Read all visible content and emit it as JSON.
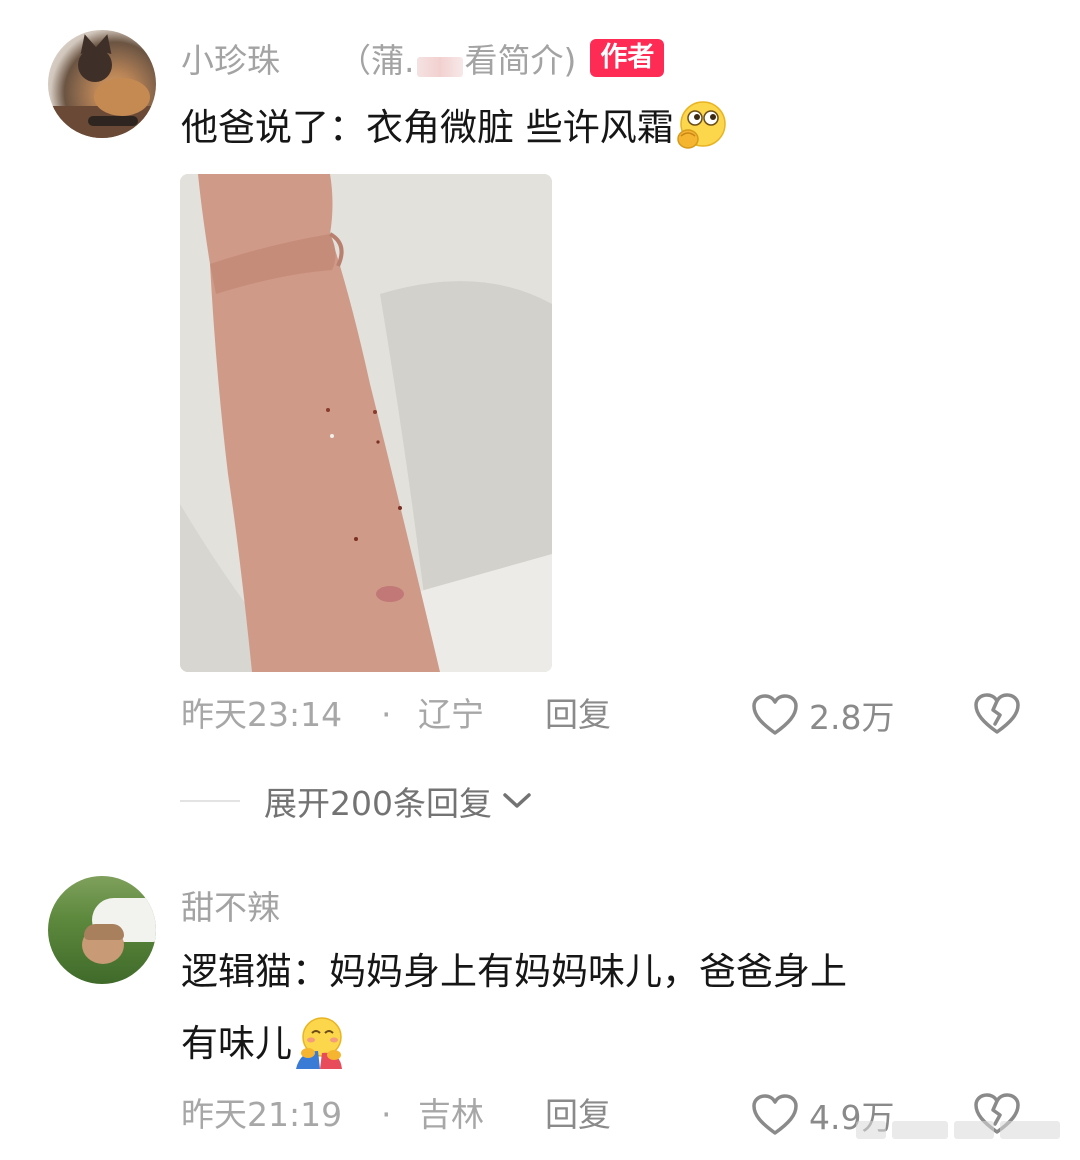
{
  "comments": [
    {
      "username": "小珍珠",
      "name_suffix_open": "（蒲.",
      "name_suffix_close": "看简介)",
      "author_badge": "作者",
      "text": "他爸说了：衣角微脏 些许风霜",
      "emoji": "hand-over-mouth-emoji",
      "has_photo": true,
      "time": "昨天23:14",
      "separator": "·",
      "region": "辽宁",
      "reply_label": "回复",
      "like_count": "2.8万"
    },
    {
      "username": "甜不辣",
      "text_line1": "逻辑猫：妈妈身上有妈妈味儿，爸爸身上",
      "text_line2": "有味儿",
      "emoji": "hugging-face-emoji",
      "time": "昨天21:19",
      "separator": "·",
      "region": "吉林",
      "reply_label": "回复",
      "like_count": "4.9万"
    }
  ],
  "expand_replies": {
    "label": "展开200条回复"
  },
  "icons": {
    "like": "heart-outline-icon",
    "dislike": "broken-heart-outline-icon",
    "expand": "chevron-down-icon"
  },
  "colors": {
    "author_badge": "#fe2c55",
    "meta_text": "#a7a7a7",
    "primary_text": "#161616"
  }
}
